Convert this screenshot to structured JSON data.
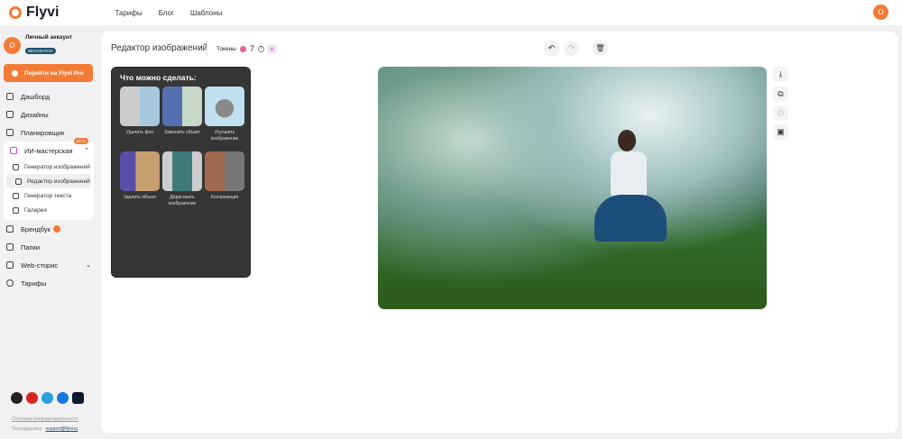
{
  "header": {
    "brand": "Flyvi",
    "nav": [
      "Тарифы",
      "Блог",
      "Шаблоны"
    ],
    "avatar_letter": "О"
  },
  "sidebar": {
    "account": {
      "letter": "О",
      "name": "Личный аккаунт",
      "plan": "БЕСПЛАТНО"
    },
    "pro_button": "Перейти на Flyvi Pro",
    "items": [
      {
        "label": "Дашборд"
      },
      {
        "label": "Дизайны"
      },
      {
        "label": "Планировщик"
      }
    ],
    "ai": {
      "label": "ИИ-мастерская",
      "badge": "BETA",
      "subitems": [
        "Генератор изображений",
        "Редактор изображений",
        "Генератор текста",
        "Галерея"
      ]
    },
    "items2": [
      {
        "label": "Брендбук"
      },
      {
        "label": "Папки"
      },
      {
        "label": "Web-сторис"
      },
      {
        "label": "Тарифы"
      }
    ],
    "privacy": "Политика конфиденциальности",
    "support_label": "Техподдержка:",
    "support_email": "support@flyvi.io"
  },
  "editor": {
    "title": "Редактор изображений",
    "tokens_label": "Токены",
    "tokens": "7",
    "plus": "+"
  },
  "card": {
    "title": "Что можно сделать:",
    "tools": [
      "Удалить фон",
      "Заменить объект",
      "Улучшить изображение",
      "Удалить объект",
      "Дорисовать изображение",
      "Колоризация"
    ]
  },
  "colors": {
    "accent": "#f47b36",
    "dark_card": "#363636"
  }
}
